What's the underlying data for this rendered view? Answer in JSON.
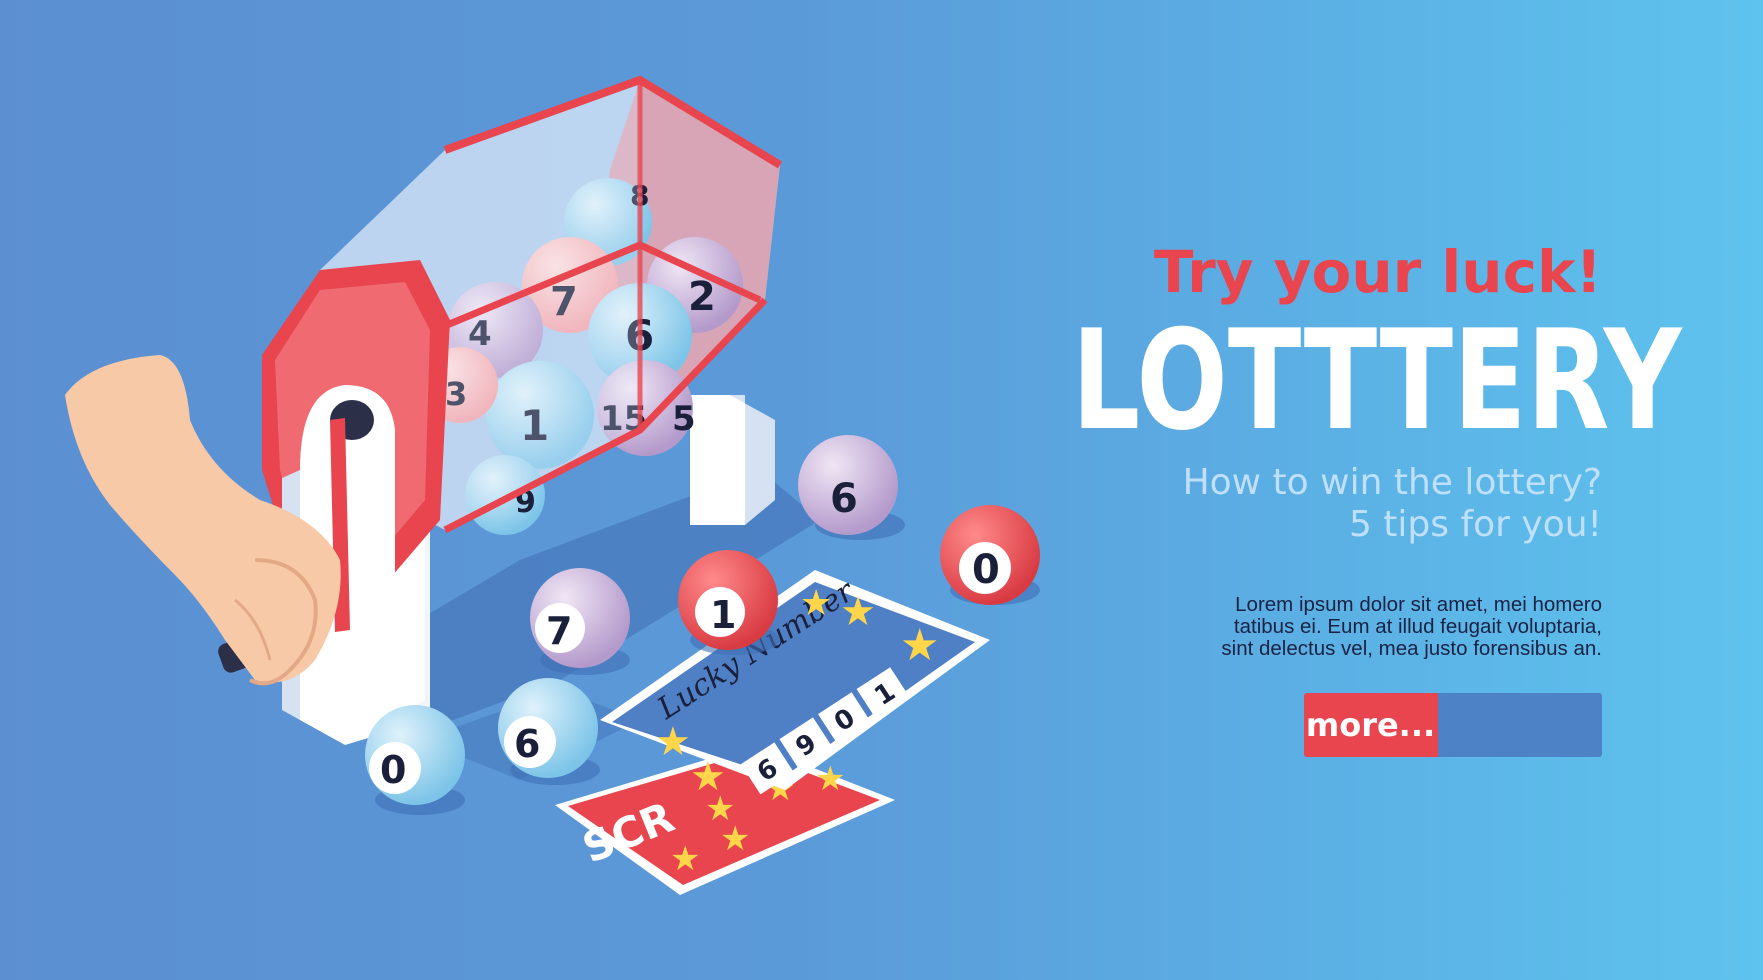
{
  "banner": {
    "tagline": "Try your luck!",
    "title": "LOTTTERY",
    "subtitle_line1": "How to win the lottery?",
    "subtitle_line2": "5 tips for you!",
    "body_line1": "Lorem ipsum dolor sit amet, mei homero",
    "body_line2": "tatibus ei. Eum at illud feugait voluptaria,",
    "body_line3": "sint delectus vel, mea justo forensibus an.",
    "more_label": "more...",
    "more_progress": 0.45
  },
  "illustration": {
    "ticket_heading": "Lucky Number",
    "ticket_digits": [
      "6",
      "9",
      "0",
      "1"
    ],
    "scratch_label": "SCR",
    "drum_balls": [
      "8",
      "2",
      "7",
      "6",
      "4",
      "1",
      "5",
      "3",
      "9",
      "15"
    ],
    "floor_balls": [
      "6",
      "0",
      "7",
      "1",
      "6",
      "0"
    ]
  },
  "colors": {
    "accent_red": "#e8454f",
    "bar_blue": "#4d82c6",
    "title_white": "#ffffff",
    "subtitle_blue": "#bfe0f8",
    "body_dark": "#1a2244"
  }
}
